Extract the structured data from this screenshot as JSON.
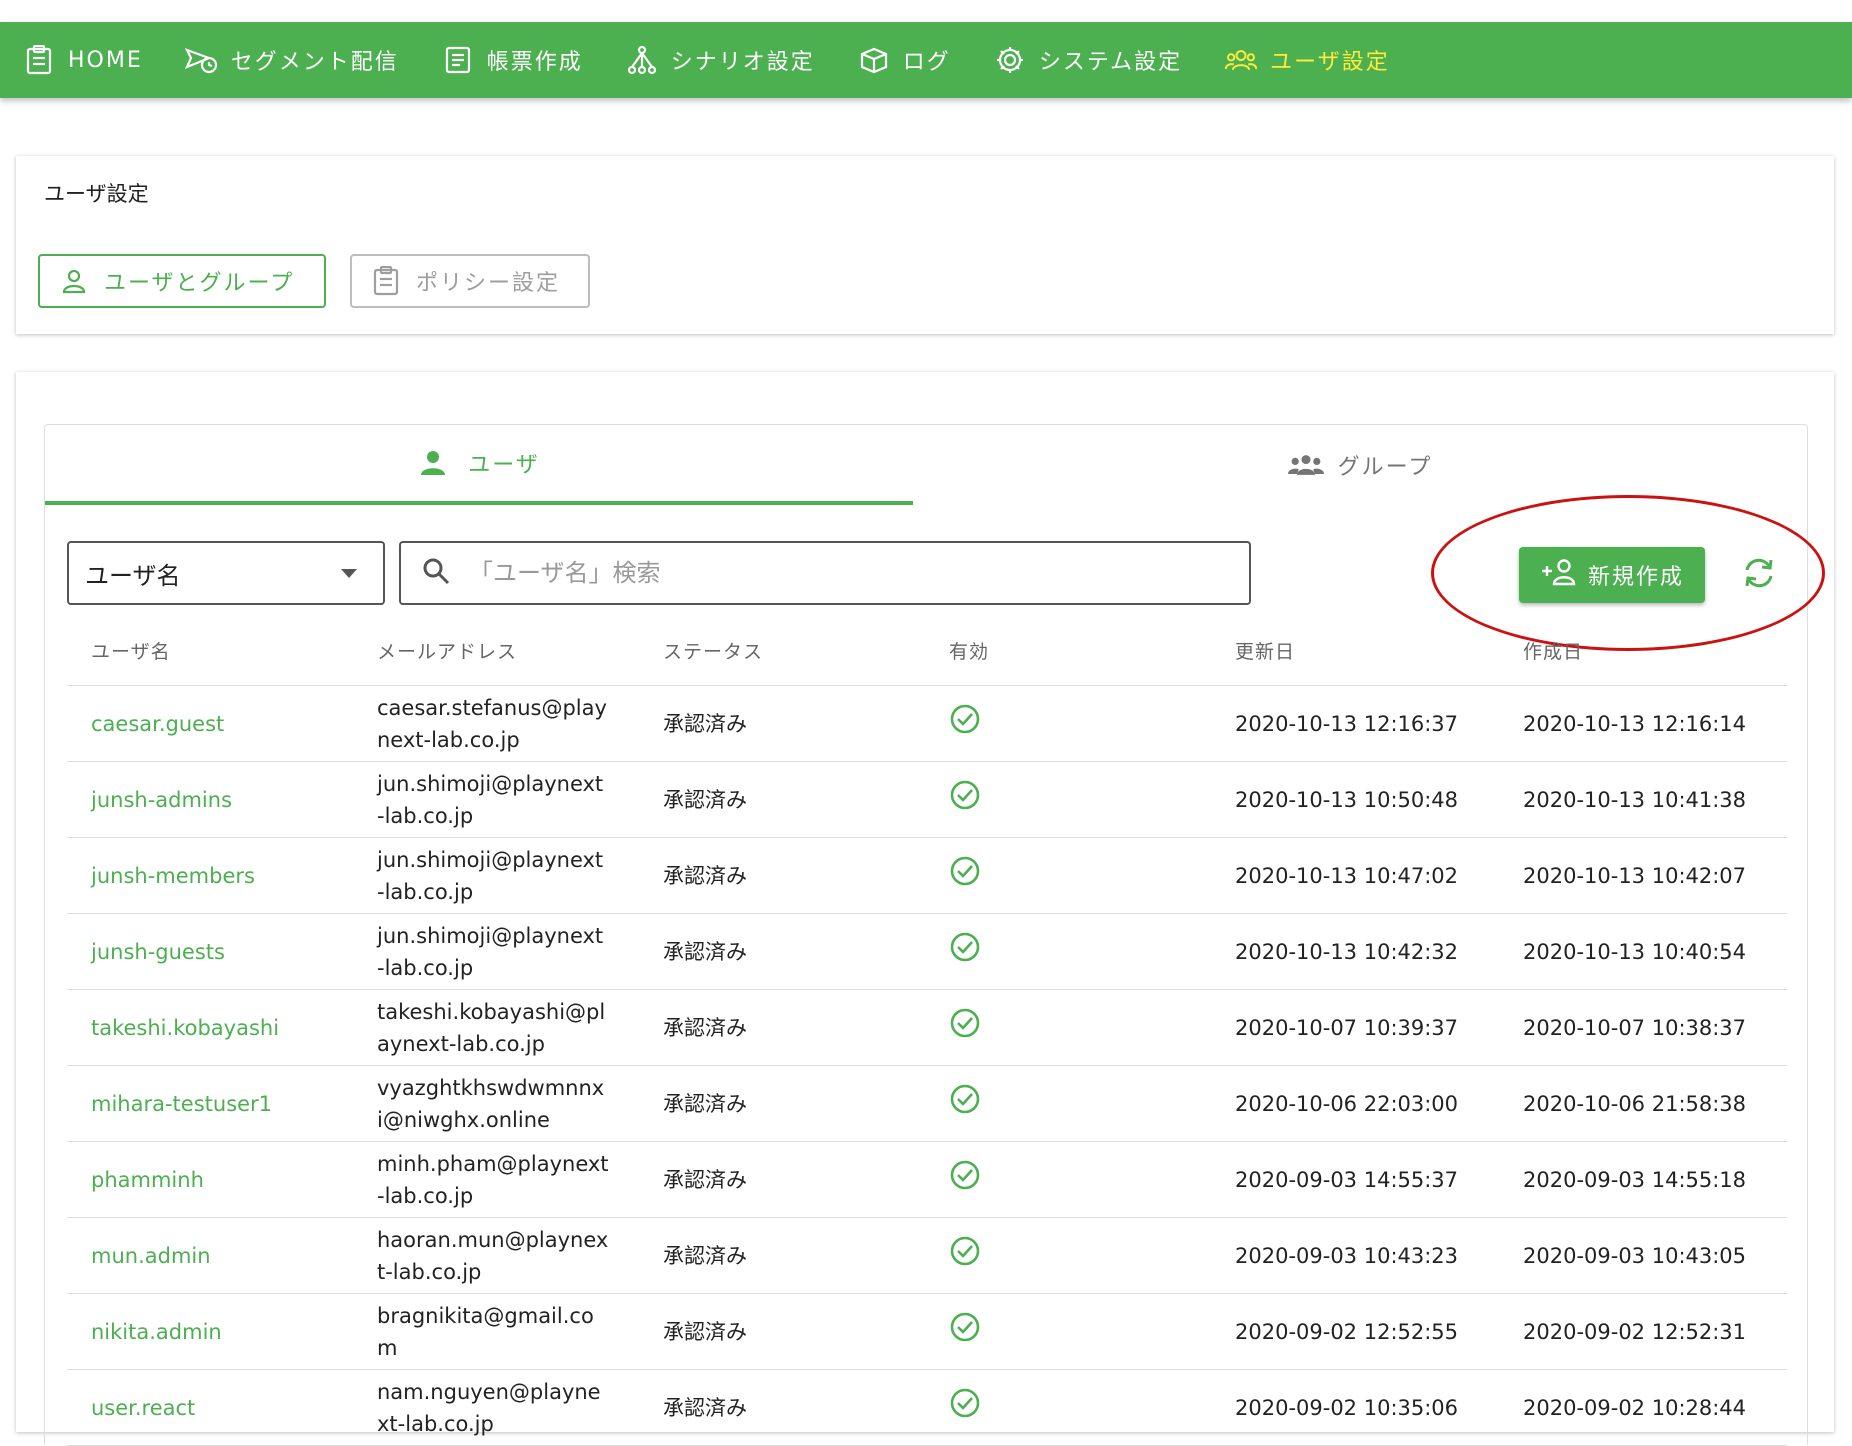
{
  "nav": {
    "items": [
      {
        "label": "HOME",
        "icon": "clipboard-icon"
      },
      {
        "label": "セグメント配信",
        "icon": "send-clock-icon"
      },
      {
        "label": "帳票作成",
        "icon": "document-icon"
      },
      {
        "label": "シナリオ設定",
        "icon": "tree-icon"
      },
      {
        "label": "ログ",
        "icon": "box-icon"
      },
      {
        "label": "システム設定",
        "icon": "gear-icon"
      },
      {
        "label": "ユーザ設定",
        "icon": "users-icon",
        "active": true
      }
    ]
  },
  "header": {
    "title": "ユーザ設定",
    "buttons": {
      "users_groups": "ユーザとグループ",
      "policy": "ポリシー設定"
    }
  },
  "tabs": {
    "users": "ユーザ",
    "groups": "グループ"
  },
  "toolbar": {
    "filter_value": "ユーザ名",
    "search_placeholder": "「ユーザ名」検索",
    "new_button": "新規作成"
  },
  "table": {
    "headers": [
      "ユーザ名",
      "メールアドレス",
      "ステータス",
      "有効",
      "更新日",
      "作成日"
    ],
    "rows": [
      {
        "name": "caesar.guest",
        "email": "caesar.stefanus@playnext-lab.co.jp",
        "status": "承認済み",
        "updated": "2020-10-13 12:16:37",
        "created": "2020-10-13 12:16:14"
      },
      {
        "name": "junsh-admins",
        "email": "jun.shimoji@playnext-lab.co.jp",
        "status": "承認済み",
        "updated": "2020-10-13 10:50:48",
        "created": "2020-10-13 10:41:38"
      },
      {
        "name": "junsh-members",
        "email": "jun.shimoji@playnext-lab.co.jp",
        "status": "承認済み",
        "updated": "2020-10-13 10:47:02",
        "created": "2020-10-13 10:42:07"
      },
      {
        "name": "junsh-guests",
        "email": "jun.shimoji@playnext-lab.co.jp",
        "status": "承認済み",
        "updated": "2020-10-13 10:42:32",
        "created": "2020-10-13 10:40:54"
      },
      {
        "name": "takeshi.kobayashi",
        "email": "takeshi.kobayashi@playnext-lab.co.jp",
        "status": "承認済み",
        "updated": "2020-10-07 10:39:37",
        "created": "2020-10-07 10:38:37"
      },
      {
        "name": "mihara-testuser1",
        "email": "vyazghtkhswdwmnnxi@niwghx.online",
        "status": "承認済み",
        "updated": "2020-10-06 22:03:00",
        "created": "2020-10-06 21:58:38"
      },
      {
        "name": "phamminh",
        "email": "minh.pham@playnext-lab.co.jp",
        "status": "承認済み",
        "updated": "2020-09-03 14:55:37",
        "created": "2020-09-03 14:55:18"
      },
      {
        "name": "mun.admin",
        "email": "haoran.mun@playnext-lab.co.jp",
        "status": "承認済み",
        "updated": "2020-09-03 10:43:23",
        "created": "2020-09-03 10:43:05"
      },
      {
        "name": "nikita.admin",
        "email": "bragnikita@gmail.com",
        "status": "承認済み",
        "updated": "2020-09-02 12:52:55",
        "created": "2020-09-02 12:52:31"
      },
      {
        "name": "user.react",
        "email": "nam.nguyen@playnext-lab.co.jp",
        "status": "承認済み",
        "updated": "2020-09-02 10:35:06",
        "created": "2020-09-02 10:28:44"
      }
    ]
  },
  "colors": {
    "accent": "#4caf50",
    "active_nav": "#ffeb3b",
    "highlight": "#cc1111"
  }
}
